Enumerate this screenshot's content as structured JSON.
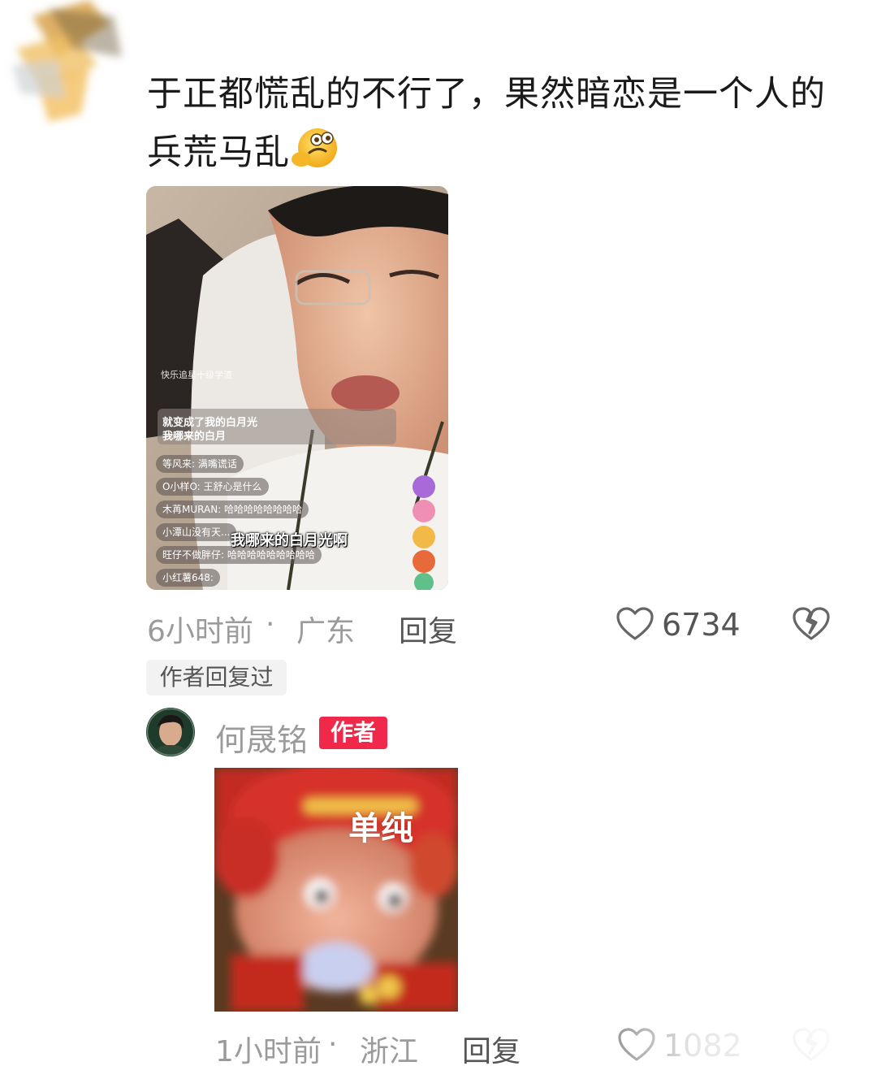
{
  "comment": {
    "text": "于正都慌乱的不行了，果然暗恋是一个人的兵荒马乱",
    "emoji": "dizzy-face-emoji",
    "video_overlay": {
      "watermark": "快乐追星十级学渣",
      "caption_line1": "就变成了我的白月光",
      "caption_line2": "我哪来的白月",
      "chat": [
        "等风来: 满嘴谎话",
        "O小样O: 王舒心是什么",
        "木苒MURAN: 哈哈哈哈哈哈哈哈",
        "小潭山没有天...",
        "旺仔不做胖仔: 哈哈哈哈哈哈哈哈哈",
        "小红薯648:"
      ],
      "subtitle": "我哪来的白月光啊"
    },
    "time": "6小时前",
    "location": "广东",
    "reply_label": "回复",
    "likes": "6734",
    "author_replied_tag": "作者回复过"
  },
  "reply": {
    "name": "何晟铭",
    "badge": "作者",
    "sticker_text": "单纯",
    "time": "1小时前",
    "location": "浙江",
    "reply_label": "回复",
    "likes": "1082"
  },
  "colors": {
    "badge_red": "#f0294b",
    "meta_gray": "#9b9b9b"
  }
}
